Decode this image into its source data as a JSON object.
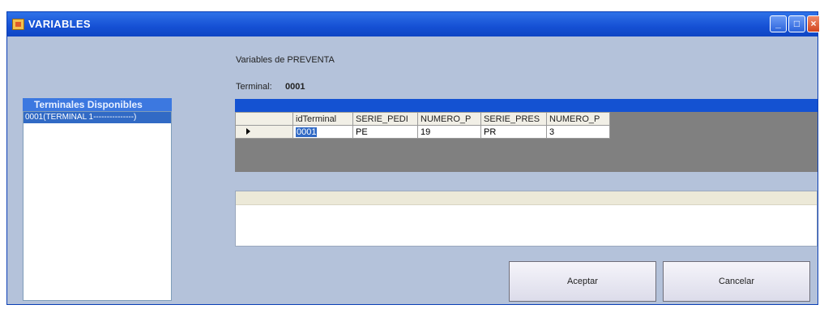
{
  "window": {
    "title": "VARIABLES"
  },
  "labels": {
    "heading": "Variables de PREVENTA",
    "terminal_label": "Terminal:",
    "terminal_value": "0001"
  },
  "terminals": {
    "header": "Terminales Disponibles",
    "items": [
      "0001(TERMINAL 1---------------)"
    ]
  },
  "grid": {
    "columns": [
      "idTerminal",
      "SERIE_PEDI",
      "NUMERO_P",
      "SERIE_PRES",
      "NUMERO_P"
    ],
    "rows": [
      [
        "0001",
        "PE",
        "19",
        "PR",
        "3"
      ]
    ]
  },
  "buttons": {
    "accept": "Aceptar",
    "cancel": "Cancelar"
  },
  "colors": {
    "titlebar": "#1550d4",
    "window_bg": "#b4c2da",
    "selection": "#316ac5"
  }
}
